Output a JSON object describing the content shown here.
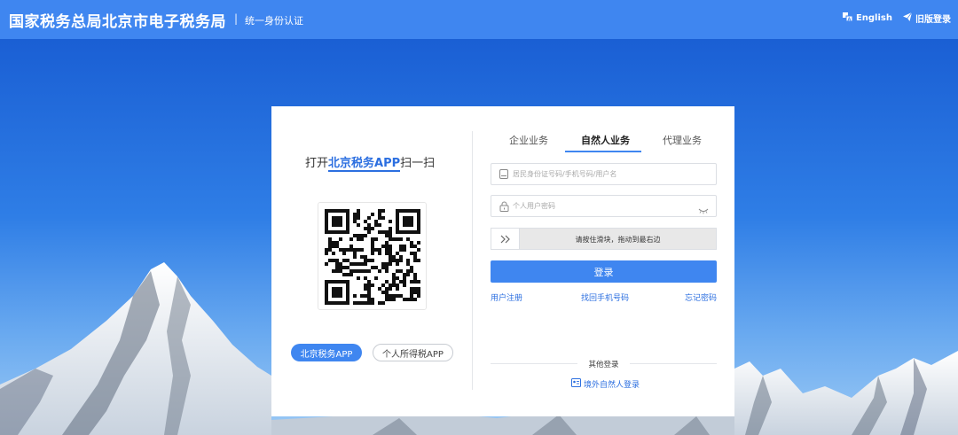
{
  "header": {
    "title": "国家税务总局北京市电子税务局",
    "separator": "|",
    "subtitle": "统一身份认证",
    "english_label": "English",
    "old_login_label": "旧版登录"
  },
  "login_card": {
    "scan": {
      "prefix": "打开",
      "app_name": "北京税务APP",
      "suffix": "扫一扫"
    },
    "app_buttons": {
      "active": "北京税务APP",
      "inactive": "个人所得税APP"
    },
    "tabs": [
      "企业业务",
      "自然人业务",
      "代理业务"
    ],
    "active_tab": "自然人业务",
    "username_placeholder": "居民身份证号码/手机号码/用户名",
    "password_placeholder": "个人用户密码",
    "slider_text": "请按住滑块，拖动到最右边",
    "login_button": "登录",
    "links": {
      "register": "用户注册",
      "recover_phone": "找回手机号码",
      "forgot_password": "忘记密码"
    },
    "other_login_title": "其他登录",
    "overseas_login": "境外自然人登录"
  },
  "colors": {
    "header_bg": "#3f86f0",
    "accent": "#3f86f0",
    "link": "#2c6fe0"
  },
  "icons": {
    "english": "translate-icon",
    "old_login": "paper-plane-icon",
    "username": "id-card-icon",
    "password": "lock-icon",
    "show_password": "eye-closed-icon",
    "slider": "double-chevron-right-icon",
    "overseas": "id-badge-icon"
  }
}
